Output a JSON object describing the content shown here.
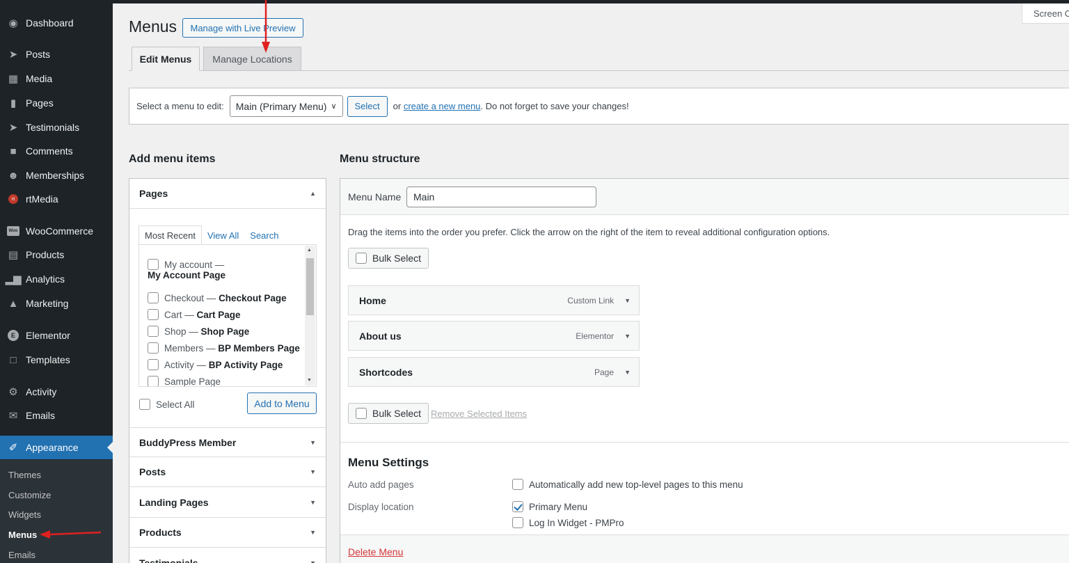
{
  "sidebar": {
    "items": [
      {
        "label": "Dashboard",
        "icon": "dashboard-icon"
      },
      {
        "label": "Posts",
        "icon": "pin-icon"
      },
      {
        "label": "Media",
        "icon": "media-icon"
      },
      {
        "label": "Pages",
        "icon": "pages-icon"
      },
      {
        "label": "Testimonials",
        "icon": "pin-icon"
      },
      {
        "label": "Comments",
        "icon": "comment-icon"
      },
      {
        "label": "Memberships",
        "icon": "groups-icon"
      },
      {
        "label": "rtMedia",
        "icon": "rtmedia-icon"
      },
      {
        "label": "WooCommerce",
        "icon": "woocommerce-icon"
      },
      {
        "label": "Products",
        "icon": "archive-icon"
      },
      {
        "label": "Analytics",
        "icon": "chart-bar-icon"
      },
      {
        "label": "Marketing",
        "icon": "megaphone-icon"
      },
      {
        "label": "Elementor",
        "icon": "elementor-icon"
      },
      {
        "label": "Templates",
        "icon": "folder-icon"
      },
      {
        "label": "Activity",
        "icon": "activity-icon"
      },
      {
        "label": "Emails",
        "icon": "email-icon"
      },
      {
        "label": "Appearance",
        "icon": "brush-icon"
      }
    ],
    "submenu": [
      "Themes",
      "Customize",
      "Widgets",
      "Menus",
      "Emails"
    ]
  },
  "header": {
    "title": "Menus",
    "live_preview": "Manage with Live Preview",
    "screen_options": "Screen Options"
  },
  "tabs": {
    "edit": "Edit Menus",
    "locations": "Manage Locations"
  },
  "select_bar": {
    "label": "Select a menu to edit:",
    "selected": "Main (Primary Menu)",
    "select_btn": "Select",
    "or_text": "or",
    "create_link": "create a new menu",
    "suffix": ". Do not forget to save your changes!"
  },
  "add_items": {
    "heading": "Add menu items",
    "pages_heading": "Pages",
    "subtabs": [
      "Most Recent",
      "View All",
      "Search"
    ],
    "pages": [
      {
        "name": "My account",
        "label": "My Account Page"
      },
      {
        "name": "Checkout",
        "label": "Checkout Page"
      },
      {
        "name": "Cart",
        "label": "Cart Page"
      },
      {
        "name": "Shop",
        "label": "Shop Page"
      },
      {
        "name": "Members",
        "label": "BP Members Page"
      },
      {
        "name": "Activity",
        "label": "BP Activity Page"
      },
      {
        "name": "Sample Page",
        "label": ""
      }
    ],
    "select_all": "Select All",
    "add_to_menu": "Add to Menu",
    "sections": [
      "BuddyPress Member",
      "Posts",
      "Landing Pages",
      "Products",
      "Testimonials"
    ]
  },
  "structure": {
    "heading": "Menu structure",
    "name_label": "Menu Name",
    "name_value": "Main",
    "instructions": "Drag the items into the order you prefer. Click the arrow on the right of the item to reveal additional configuration options.",
    "bulk_select": "Bulk Select",
    "remove_selected": "Remove Selected Items",
    "items": [
      {
        "title": "Home",
        "type": "Custom Link"
      },
      {
        "title": "About us",
        "type": "Elementor"
      },
      {
        "title": "Shortcodes",
        "type": "Page"
      }
    ],
    "settings_heading": "Menu Settings",
    "auto_add_label": "Auto add pages",
    "auto_add_text": "Automatically add new top-level pages to this menu",
    "display_label": "Display location",
    "locations": [
      {
        "label": "Primary Menu",
        "checked": true
      },
      {
        "label": "Log In Widget - PMPro",
        "checked": false
      }
    ],
    "delete": "Delete Menu"
  }
}
